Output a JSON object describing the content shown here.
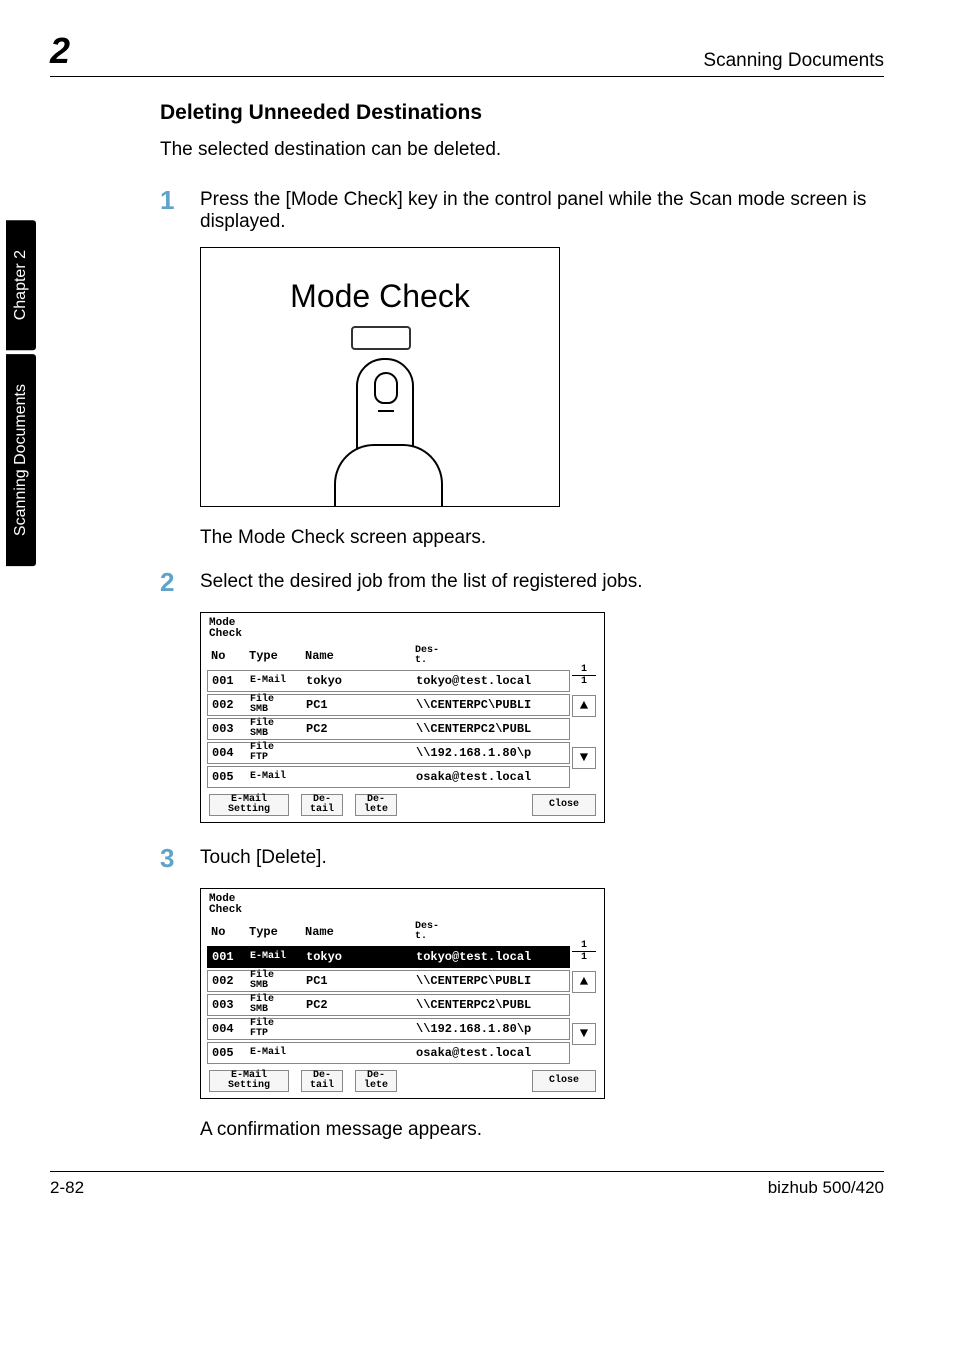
{
  "header": {
    "chapter_number": "2",
    "header_right": "Scanning Documents"
  },
  "side_tabs": {
    "lower": "Scanning Documents",
    "upper": "Chapter 2"
  },
  "section": {
    "title": "Deleting Unneeded Destinations",
    "intro": "The selected destination can be deleted."
  },
  "steps": {
    "s1": {
      "num": "1",
      "text": "Press the [Mode Check] key in the control panel while the Scan mode screen is displayed.",
      "after": "The Mode Check screen appears."
    },
    "s2": {
      "num": "2",
      "text": "Select the desired job from the list of registered jobs."
    },
    "s3": {
      "num": "3",
      "text": "Touch [Delete].",
      "after": "A confirmation message appears."
    }
  },
  "modecheck_image": {
    "label": "Mode Check"
  },
  "screen": {
    "title1": "Mode",
    "title2": "Check",
    "header": {
      "no": "No",
      "type": "Type",
      "name": "Name",
      "dest1": "Des-",
      "dest2": "t."
    },
    "rows": [
      {
        "no": "001",
        "type": "E-Mail",
        "name": "tokyo",
        "dest": "tokyo@test.local"
      },
      {
        "no": "002",
        "type1": "File",
        "type2": "SMB",
        "name": "PC1",
        "dest": "\\\\CENTERPC\\PUBLI"
      },
      {
        "no": "003",
        "type1": "File",
        "type2": "SMB",
        "name": "PC2",
        "dest": "\\\\CENTERPC2\\PUBL"
      },
      {
        "no": "004",
        "type1": "File",
        "type2": "FTP",
        "name": "",
        "dest": "\\\\192.168.1.80\\p"
      },
      {
        "no": "005",
        "type": "E-Mail",
        "name": "",
        "dest": "osaka@test.local"
      }
    ],
    "page_current": "1",
    "page_total": "1",
    "arrow_up": "▲",
    "arrow_down": "▼",
    "footer": {
      "email1": "E-Mail",
      "email2": "Setting",
      "detail1": "De-",
      "detail2": "tail",
      "delete1": "De-",
      "delete2": "lete",
      "close": "Close"
    }
  },
  "page_footer": {
    "left": "2-82",
    "right": "bizhub 500/420"
  }
}
